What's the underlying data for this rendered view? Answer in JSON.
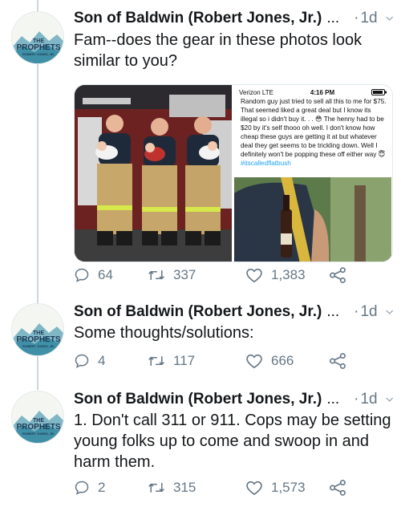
{
  "tweets": [
    {
      "author": "Son of Baldwin (Robert Jones, Jr.)",
      "ellipsis": "...",
      "separator": "·",
      "time": "1d",
      "text": "Fam--does the gear in these photos look similar to you?",
      "replies": "64",
      "retweets": "337",
      "likes": "1,383",
      "screenshot": {
        "carrier": "Verizon  LTE",
        "clock": "4:16 PM",
        "text": "Random guy just tried to sell all this to me for $75. That seemed liked a great deal but I know its illegal so i didn't buy it. . . 😳 The henny had to be $20 by it's self thooo oh well.  I don't know how cheap these guys are getting it at but whatever deal they get seems to be trickling down. Well I definitely won't be popping these off either way 😇",
        "hashtag": "#itscalledflatbush"
      }
    },
    {
      "author": "Son of Baldwin (Robert Jones, Jr.)",
      "ellipsis": "...",
      "separator": "·",
      "time": "1d",
      "text": "Some thoughts/solutions:",
      "replies": "4",
      "retweets": "117",
      "likes": "666"
    },
    {
      "author": "Son of Baldwin (Robert Jones, Jr.)",
      "ellipsis": "...",
      "separator": "·",
      "time": "1d",
      "text": "1. Don't call 311 or 911. Cops may be setting young folks up to come and swoop in and harm them.",
      "replies": "2",
      "retweets": "315",
      "likes": "1,573"
    }
  ],
  "avatar": {
    "line1": "THE",
    "line2": "PROPHETS",
    "line3": "ROBERT JONES, JR."
  },
  "icons": {
    "reply": "reply-icon",
    "retweet": "retweet-icon",
    "like": "heart-icon",
    "share": "share-icon",
    "caret": "chevron-down-icon"
  },
  "colors": {
    "text": "#14171a",
    "secondary": "#657786",
    "link": "#1da1f2",
    "thread_line": "#ccd6dd"
  }
}
